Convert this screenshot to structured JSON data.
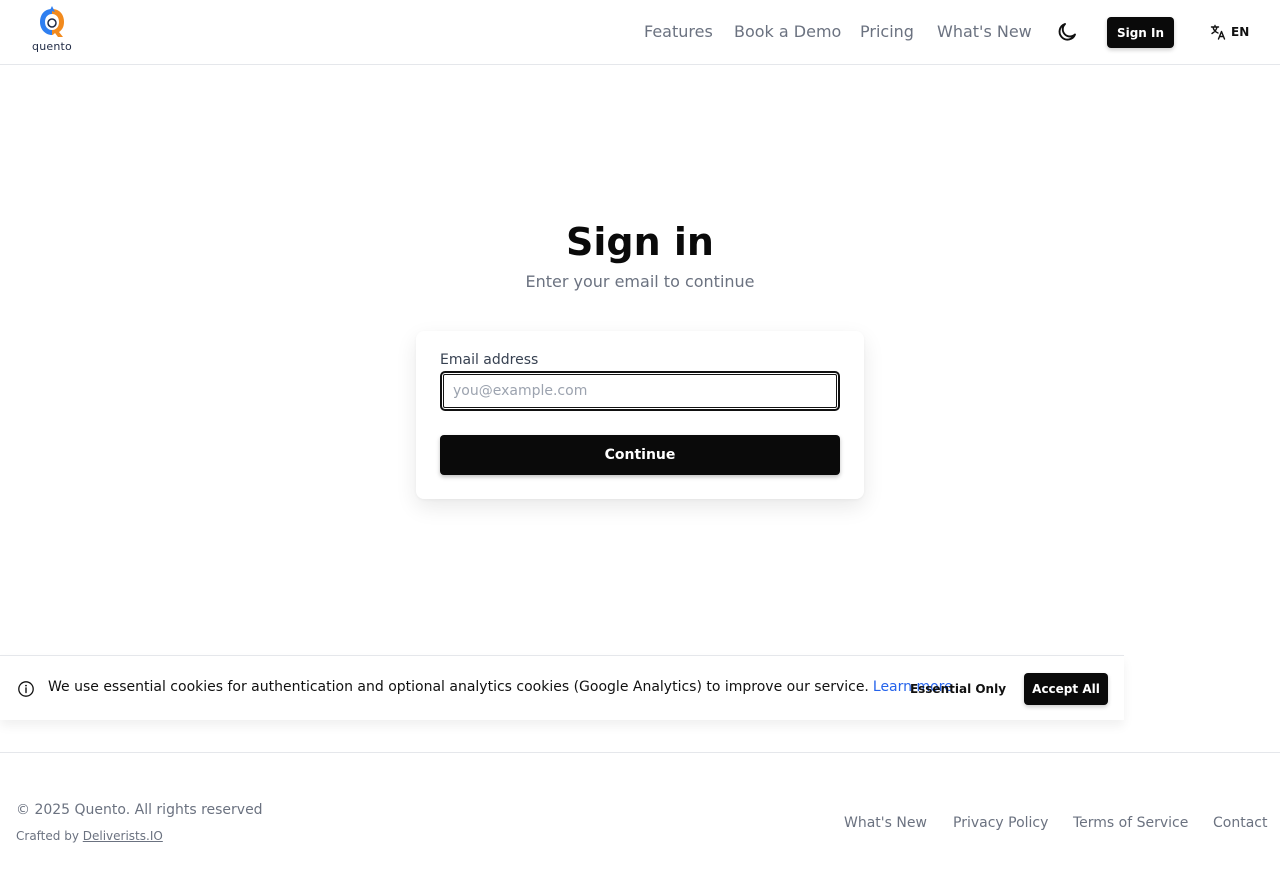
{
  "header": {
    "logo_text": "quento",
    "nav": [
      "Features",
      "Book a Demo",
      "Pricing",
      "What's New"
    ],
    "theme_toggle_icon": "moon-icon",
    "sign_in_label": "Sign In",
    "language_icon": "translate-icon",
    "language_label": "EN"
  },
  "main": {
    "title": "Sign in",
    "subtitle": "Enter your email to continue",
    "email_label": "Email address",
    "email_placeholder": "you@example.com",
    "email_value": "",
    "continue_label": "Continue"
  },
  "cookie_banner": {
    "icon": "info-icon",
    "message": "We use essential cookies for authentication and optional analytics cookies (Google Analytics) to improve our service.",
    "learn_more_label": "Learn more",
    "essential_label": "Essential Only",
    "accept_label": "Accept All"
  },
  "footer": {
    "copyright": "© 2025 Quento. All rights reserved",
    "crafted_prefix": "Crafted by",
    "crafted_link": "Deliverists.IO",
    "links": [
      "What's New",
      "Privacy Policy",
      "Terms of Service",
      "Contact"
    ]
  },
  "colors": {
    "primary": "#0a0a0a",
    "link": "#2563eb",
    "muted_text": "#6b7280",
    "logo_blue": "#2f7ff0",
    "logo_orange": "#f28a1d"
  }
}
